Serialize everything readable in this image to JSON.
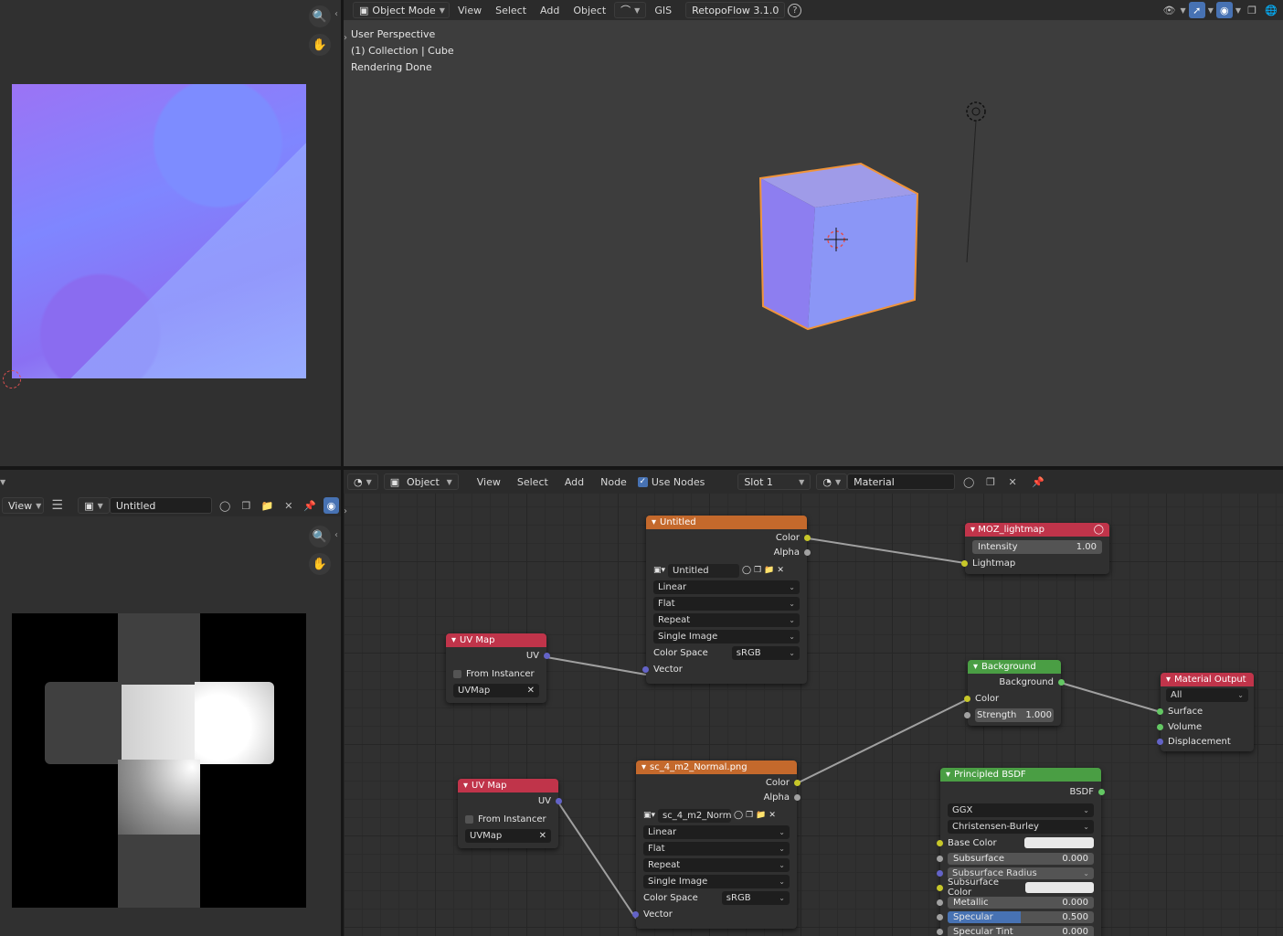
{
  "top_header": {
    "mode": "Object Mode",
    "menus": [
      "View",
      "Select",
      "Add",
      "Object"
    ],
    "gis": "GIS",
    "retopo": "RetopoFlow 3.1.0",
    "help": "?"
  },
  "viewport": {
    "overlay_lines": [
      "User Perspective",
      "(1) Collection | Cube",
      "Rendering Done"
    ]
  },
  "image_editor": {
    "view_label": "View",
    "image_name": "Untitled"
  },
  "node_header": {
    "editor_type": "Object",
    "menus": [
      "View",
      "Select",
      "Add",
      "Node"
    ],
    "use_nodes": "Use Nodes",
    "slot": "Slot 1",
    "material": "Material"
  },
  "nodes": {
    "tex1": {
      "title": "Untitled",
      "out_color": "Color",
      "out_alpha": "Alpha",
      "image": "Untitled",
      "interp": "Linear",
      "proj": "Flat",
      "ext": "Repeat",
      "source": "Single Image",
      "cs_label": "Color Space",
      "cs_value": "sRGB",
      "in_vector": "Vector"
    },
    "tex2": {
      "title": "sc_4_m2_Normal.png",
      "out_color": "Color",
      "out_alpha": "Alpha",
      "image": "sc_4_m2_Norm...",
      "interp": "Linear",
      "proj": "Flat",
      "ext": "Repeat",
      "source": "Single Image",
      "cs_label": "Color Space",
      "cs_value": "sRGB",
      "in_vector": "Vector"
    },
    "uv1": {
      "title": "UV Map",
      "out": "UV",
      "from_instancer": "From Instancer",
      "map": "UVMap"
    },
    "uv2": {
      "title": "UV Map",
      "out": "UV",
      "from_instancer": "From Instancer",
      "map": "UVMap"
    },
    "moz": {
      "title": "MOZ_lightmap",
      "intensity_label": "Intensity",
      "intensity": "1.00",
      "in_lightmap": "Lightmap"
    },
    "bg": {
      "title": "Background",
      "out": "Background",
      "in_color": "Color",
      "strength_label": "Strength",
      "strength": "1.000"
    },
    "out": {
      "title": "Material Output",
      "target": "All",
      "surface": "Surface",
      "volume": "Volume",
      "displacement": "Displacement"
    },
    "bsdf": {
      "title": "Principled BSDF",
      "out": "BSDF",
      "dist": "GGX",
      "sss": "Christensen-Burley",
      "base_color": "Base Color",
      "subsurface": "Subsurface",
      "subsurface_v": "0.000",
      "ss_radius": "Subsurface Radius",
      "ss_color": "Subsurface Color",
      "metallic": "Metallic",
      "metallic_v": "0.000",
      "specular": "Specular",
      "specular_v": "0.500",
      "specular_fill": 0.5,
      "spec_tint": "Specular Tint",
      "spec_tint_v": "0.000"
    }
  }
}
